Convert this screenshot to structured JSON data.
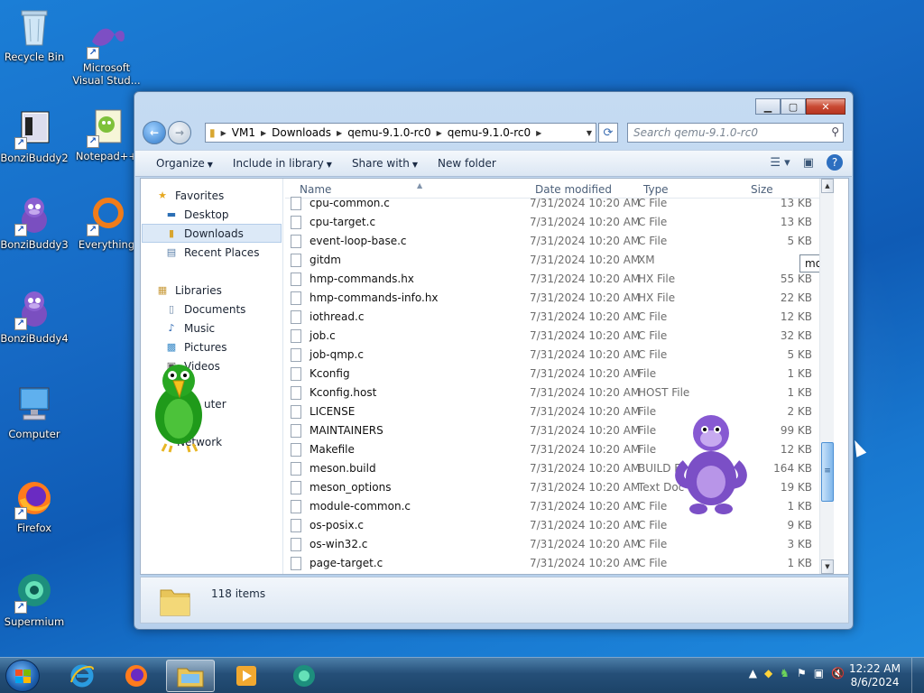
{
  "desktop": {
    "icons": [
      {
        "label": "Recycle Bin",
        "icon": "recycle-bin-icon"
      },
      {
        "label": "Microsoft Visual Stud...",
        "icon": "visual-studio-icon"
      },
      {
        "label": "BonziBuddy2",
        "icon": "bonzibuddy-icon"
      },
      {
        "label": "Notepad++",
        "icon": "notepadpp-icon"
      },
      {
        "label": "BonziBuddy3",
        "icon": "bonzibuddy-icon"
      },
      {
        "label": "Everything",
        "icon": "everything-icon"
      },
      {
        "label": "BonziBuddy4",
        "icon": "bonzibuddy-icon"
      },
      {
        "label": "Computer",
        "icon": "computer-icon"
      },
      {
        "label": "Firefox",
        "icon": "firefox-icon"
      },
      {
        "label": "Supermium",
        "icon": "supermium-icon"
      }
    ]
  },
  "window": {
    "address": {
      "segments": [
        "VM1",
        "Downloads",
        "qemu-9.1.0-rc0",
        "qemu-9.1.0-rc0"
      ]
    },
    "search_placeholder": "Search qemu-9.1.0-rc0",
    "toolbar": {
      "organize": "Organize",
      "include_in_library": "Include in library",
      "share_with": "Share with",
      "new_folder": "New folder"
    },
    "sidebar": {
      "favorites": "Favorites",
      "desktop": "Desktop",
      "downloads": "Downloads",
      "recent_places": "Recent Places",
      "libraries": "Libraries",
      "documents": "Documents",
      "music": "Music",
      "pictures": "Pictures",
      "videos": "Videos",
      "computer": "uter",
      "network": "Network"
    },
    "columns": {
      "name": "Name",
      "date": "Date modified",
      "type": "Type",
      "size": "Size"
    },
    "files": [
      {
        "name": "cpu-common.c",
        "date": "7/31/2024 10:20 AM",
        "type": "C File",
        "size": "13 KB"
      },
      {
        "name": "cpu-target.c",
        "date": "7/31/2024 10:20 AM",
        "type": "C File",
        "size": "13 KB"
      },
      {
        "name": "event-loop-base.c",
        "date": "7/31/2024 10:20 AM",
        "type": "C File",
        "size": "5 KB"
      },
      {
        "name": "gitdm",
        "date": "7/31/2024 10:20 AM",
        "type": "XM",
        "size": ""
      },
      {
        "name": "hmp-commands.hx",
        "date": "7/31/2024 10:20 AM",
        "type": "HX File",
        "size": "55 KB"
      },
      {
        "name": "hmp-commands-info.hx",
        "date": "7/31/2024 10:20 AM",
        "type": "HX File",
        "size": "22 KB"
      },
      {
        "name": "iothread.c",
        "date": "7/31/2024 10:20 AM",
        "type": "C File",
        "size": "12 KB"
      },
      {
        "name": "job.c",
        "date": "7/31/2024 10:20 AM",
        "type": "C File",
        "size": "32 KB"
      },
      {
        "name": "job-qmp.c",
        "date": "7/31/2024 10:20 AM",
        "type": "C File",
        "size": "5 KB"
      },
      {
        "name": "Kconfig",
        "date": "7/31/2024 10:20 AM",
        "type": "File",
        "size": "1 KB"
      },
      {
        "name": "Kconfig.host",
        "date": "7/31/2024 10:20 AM",
        "type": "HOST File",
        "size": "1 KB"
      },
      {
        "name": "LICENSE",
        "date": "7/31/2024 10:20 AM",
        "type": "File",
        "size": "2 KB"
      },
      {
        "name": "MAINTAINERS",
        "date": "7/31/2024 10:20 AM",
        "type": "File",
        "size": "99 KB"
      },
      {
        "name": "Makefile",
        "date": "7/31/2024 10:20 AM",
        "type": "File",
        "size": "12 KB"
      },
      {
        "name": "meson.build",
        "date": "7/31/2024 10:20 AM",
        "type": "BUILD F",
        "size": "164 KB"
      },
      {
        "name": "meson_options",
        "date": "7/31/2024 10:20 AM",
        "type": "Text Doc",
        "size": "19 KB"
      },
      {
        "name": "module-common.c",
        "date": "7/31/2024 10:20 AM",
        "type": "C File",
        "size": "1 KB"
      },
      {
        "name": "os-posix.c",
        "date": "7/31/2024 10:20 AM",
        "type": "C File",
        "size": "9 KB"
      },
      {
        "name": "os-win32.c",
        "date": "7/31/2024 10:20 AM",
        "type": "C File",
        "size": "3 KB"
      },
      {
        "name": "page-target.c",
        "date": "7/31/2024 10:20 AM",
        "type": "C File",
        "size": "1 KB"
      }
    ],
    "tooltip": "module-common.c",
    "status": {
      "item_count": "118 items"
    }
  },
  "taskbar": {
    "clock_time": "12:22 AM",
    "clock_date": "8/6/2024"
  }
}
